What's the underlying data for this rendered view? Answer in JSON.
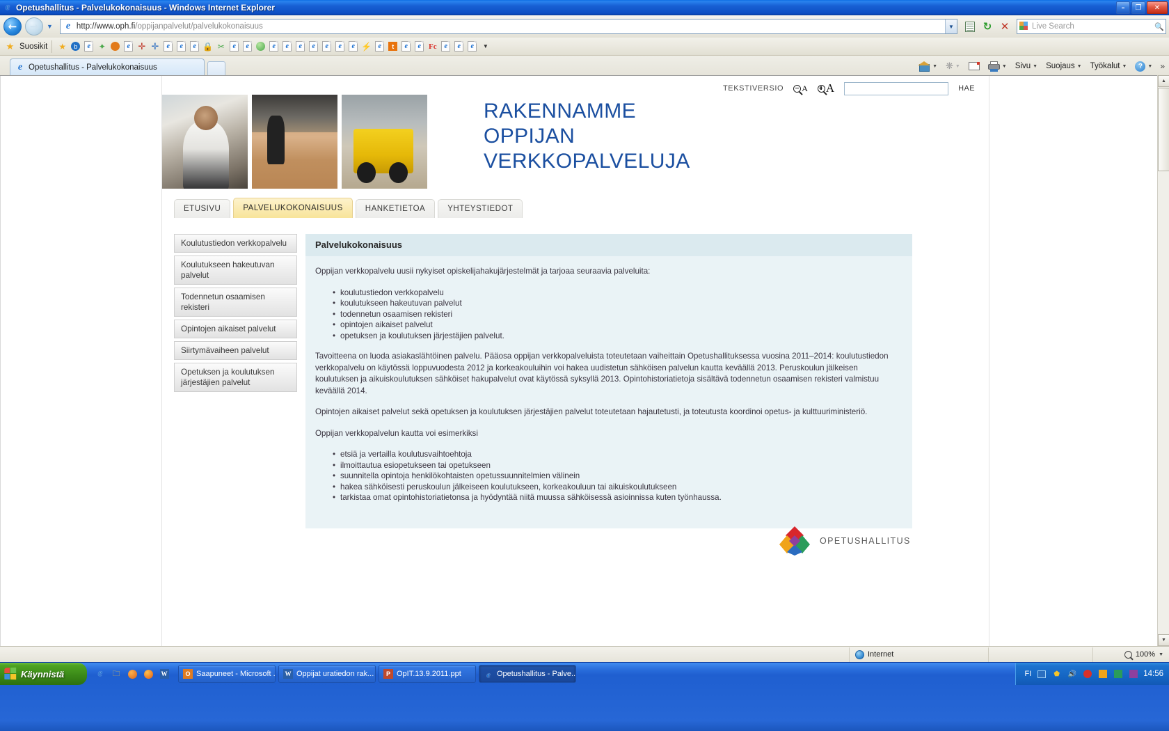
{
  "window": {
    "title": "Opetushallitus - Palvelukokonaisuus - Windows Internet Explorer",
    "minimize": "–",
    "maximize": "❐",
    "close": "✕"
  },
  "browser": {
    "address": {
      "protocol_host": "http://www.oph.fi",
      "path": "/oppijanpalvelut/palvelukokonaisuus",
      "full": "http://www.oph.fi/oppijanpalvelut/palvelukokonaisuus"
    },
    "search_placeholder": "Live Search",
    "favorites_label": "Suosikit",
    "tab_label": "Opetushallitus - Palvelukokonaisuus",
    "commands": [
      {
        "name": "home",
        "label": ""
      },
      {
        "name": "feeds",
        "label": ""
      },
      {
        "name": "mail",
        "label": ""
      },
      {
        "name": "print",
        "label": ""
      },
      {
        "name": "page",
        "label": "Sivu"
      },
      {
        "name": "safety",
        "label": "Suojaus"
      },
      {
        "name": "tools",
        "label": "Työkalut"
      },
      {
        "name": "help",
        "label": ""
      }
    ]
  },
  "site": {
    "utility": {
      "textversion": "TEKSTIVERSIO",
      "search_value": "",
      "search_button": "HAE"
    },
    "hero_title_lines": [
      "RAKENNAMME",
      "OPPIJAN",
      "VERKKOPALVELUJA"
    ],
    "tabs": [
      {
        "label": "ETUSIVU",
        "active": false
      },
      {
        "label": "PALVELUKOKONAISUUS",
        "active": true
      },
      {
        "label": "HANKETIETOA",
        "active": false
      },
      {
        "label": "YHTEYSTIEDOT",
        "active": false
      }
    ],
    "sidebar": [
      "Koulutustiedon verkkopalvelu",
      "Koulutukseen hakeutuvan palvelut",
      "Todennetun osaamisen rekisteri",
      "Opintojen aikaiset palvelut",
      "Siirtymävaiheen palvelut",
      "Opetuksen ja koulutuksen järjestäjien palvelut"
    ],
    "content": {
      "heading": "Palvelukokonaisuus",
      "intro": "Oppijan verkkopalvelu uusii nykyiset opiskelijahakujärjestelmät ja tarjoaa seuraavia palveluita:",
      "services": [
        "koulutustiedon verkkopalvelu",
        "koulutukseen hakeutuvan palvelut",
        "todennetun osaamisen rekisteri",
        "opintojen aikaiset palvelut",
        "opetuksen ja koulutuksen järjestäjien palvelut."
      ],
      "paragraph2": "Tavoitteena on luoda asiakaslähtöinen palvelu. Pääosa oppijan verkkopalveluista toteutetaan vaiheittain Opetushallituksessa vuosina 2011–2014: koulutustiedon verkkopalvelu on käytössä loppuvuodesta 2012 ja korkeakouluihin voi hakea uudistetun sähköisen palvelun kautta keväällä 2013. Peruskoulun jälkeisen koulutuksen ja aikuiskoulutuksen sähköiset hakupalvelut ovat käytössä syksyllä 2013. Opintohistoriatietoja sisältävä todennetun osaamisen rekisteri valmistuu keväällä 2014.",
      "paragraph3": "Opintojen aikaiset palvelut sekä opetuksen ja koulutuksen järjestäjien palvelut toteutetaan hajautetusti, ja toteutusta koordinoi opetus- ja kulttuuriministeriö.",
      "paragraph4": "Oppijan verkkopalvelun kautta voi esimerkiksi",
      "examples": [
        "etsiä ja vertailla koulutusvaihtoehtoja",
        "ilmoittautua esiopetukseen tai opetukseen",
        "suunnitella opintoja henkilökohtaisten opetussuunnitelmien välinein",
        "hakea sähköisesti peruskoulun jälkeiseen koulutukseen, korkeakouluun tai aikuiskoulutukseen",
        "tarkistaa omat opintohistoriatietonsa ja hyödyntää niitä muussa sähköisessä asioinnissa kuten työnhaussa."
      ]
    },
    "logo_text": "OPETUSHALLITUS"
  },
  "status": {
    "zone": "Internet",
    "zoom": "100%"
  },
  "taskbar": {
    "start": "Käynnistä",
    "tasks": [
      {
        "label": "Saapuneet - Microsoft ...",
        "active": false
      },
      {
        "label": "Oppijat uratiedon rak...",
        "active": false
      },
      {
        "label": "OpIT.13.9.2011.ppt",
        "active": false
      },
      {
        "label": "Opetushallitus - Palve...",
        "active": true
      }
    ],
    "language": "FI",
    "time": "14:56"
  },
  "colors": {
    "hero_blue": "#1b4fa0",
    "tab_active": "#f8e49a",
    "panel_bg": "#eaf3f6",
    "panel_head": "#dbeaef"
  }
}
